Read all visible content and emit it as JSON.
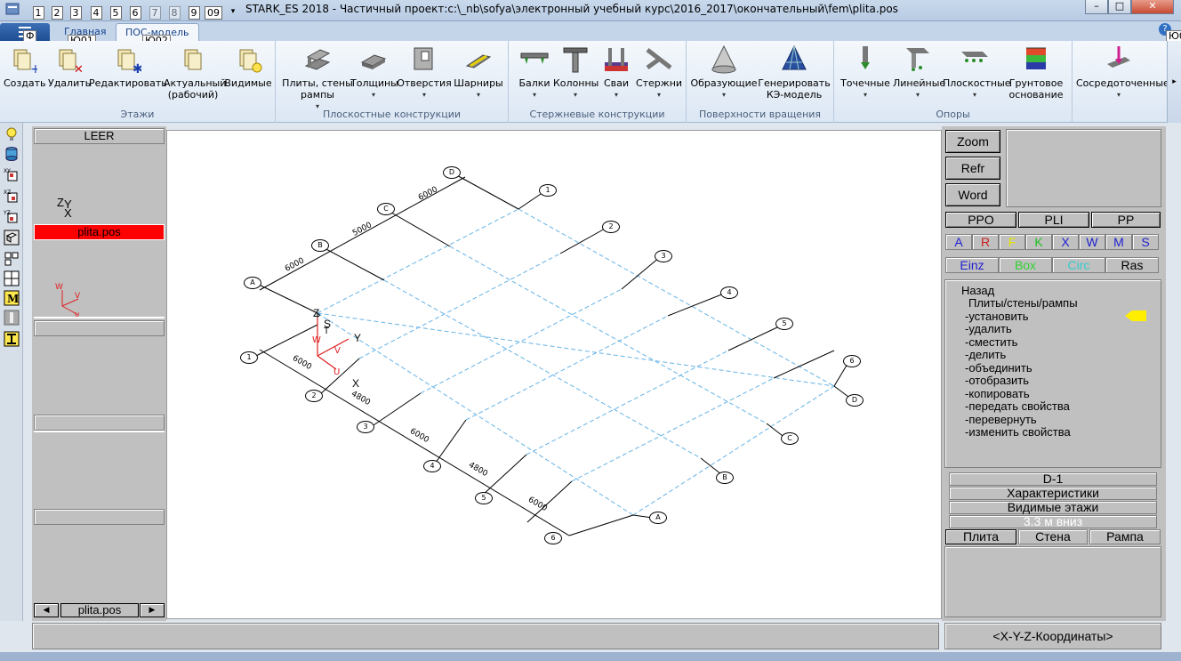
{
  "window": {
    "title": "STARK_ES 2018 - Частичный проект:c:\\_nb\\sofya\\электронный учебный курс\\2016_2017\\окончательный\\fem\\plita.pos",
    "minimize": "–",
    "maximize": "□",
    "close": "✕"
  },
  "qat": [
    "1",
    "2",
    "3",
    "4",
    "5",
    "6",
    "7",
    "8",
    "9",
    "09"
  ],
  "tabs": {
    "file_keytip": "Ф",
    "main": "Главная",
    "main_keytip": "Ю01",
    "pos_model": "ПОС-модель",
    "pos_keytip": "Ю02",
    "help_keytip": "Ю0"
  },
  "ribbon": {
    "groups": [
      {
        "label": "Этажи",
        "buttons": [
          "Создать",
          "Удалить",
          "Редактировать",
          "Актуальный (рабочий)",
          "Видимые"
        ]
      },
      {
        "label": "Плоскостные конструкции",
        "buttons": [
          "Плиты, стены рампы",
          "Толщины",
          "Отверстия",
          "Шарниры"
        ]
      },
      {
        "label": "Стержневые конструкции",
        "buttons": [
          "Балки",
          "Колонны",
          "Сваи",
          "Стержни"
        ]
      },
      {
        "label": "Поверхности вращения",
        "buttons": [
          "Образующие",
          "Генерировать КЭ-модель"
        ]
      },
      {
        "label": "Опоры",
        "buttons": [
          "Точечные",
          "Линейные",
          "Плоскостные",
          "Грунтовое основание"
        ]
      },
      {
        "label": "",
        "buttons": [
          "Сосредоточенные"
        ]
      }
    ]
  },
  "left_panel": {
    "header": "LEER",
    "axis_z": "Z",
    "axis_y": "Y",
    "axis_x": "X",
    "axis_w": "W",
    "axis_v": "V",
    "axis_u": "U",
    "file": "plita.pos",
    "nav_prev": "◀",
    "nav_next": "▶",
    "nav_file": "plita.pos"
  },
  "canvas": {
    "axis_labels_left": [
      "A",
      "B",
      "C",
      "D"
    ],
    "axis_labels_right_numbers": [
      "1",
      "2",
      "3",
      "4",
      "5",
      "6"
    ],
    "dims_top": [
      "6000",
      "5000",
      "6000"
    ],
    "dims_bottom": [
      "6000",
      "4800",
      "6000",
      "4800",
      "6000"
    ],
    "origin": {
      "z": "Z",
      "s": "S",
      "y": "Y",
      "x": "X",
      "w": "W",
      "v": "V",
      "u": "U",
      "t": "T"
    }
  },
  "right_panel": {
    "zoom": "Zoom",
    "refr": "Refr",
    "word": "Word",
    "ppo": "PPO",
    "pli": "PLI",
    "pp": "PP",
    "flags": [
      {
        "label": "A",
        "color": "#1f1fd0"
      },
      {
        "label": "R",
        "color": "#d01f1f"
      },
      {
        "label": "F",
        "color": "#e6e600"
      },
      {
        "label": "K",
        "color": "#1fbf1f"
      },
      {
        "label": "X",
        "color": "#1f1fd0"
      },
      {
        "label": "W",
        "color": "#1f1fd0"
      },
      {
        "label": "M",
        "color": "#1f1fd0"
      },
      {
        "label": "S",
        "color": "#1f1fd0"
      }
    ],
    "modes": [
      {
        "label": "Einz",
        "color": "#1f1fd0"
      },
      {
        "label": "Box",
        "color": "#2fd02f"
      },
      {
        "label": "Circ",
        "color": "#33cccc"
      },
      {
        "label": "Ras",
        "color": "#000000"
      }
    ],
    "menu": {
      "back": "Назад",
      "section": "Плиты/стены/рампы",
      "items": [
        "-установить",
        "-удалить",
        "-сместить",
        "-делить",
        "-объединить",
        "-отобразить",
        "-копировать",
        "-передать свойства",
        "-перевернуть",
        "-изменить свойства"
      ]
    },
    "layer": "D-1",
    "characteristics": "Характеристики",
    "visible_floors": "Видимые этажи",
    "floor_down": "3.3 м вниз",
    "tab_plate": "Плита",
    "tab_wall": "Стена",
    "tab_ramp": "Рампа"
  },
  "status": {
    "coords": "<X-Y-Z-Координаты>"
  },
  "colors": {
    "selected_file": "#ff0000",
    "grid_dashed": "#66b3e6",
    "pointer": "#ffee00"
  }
}
